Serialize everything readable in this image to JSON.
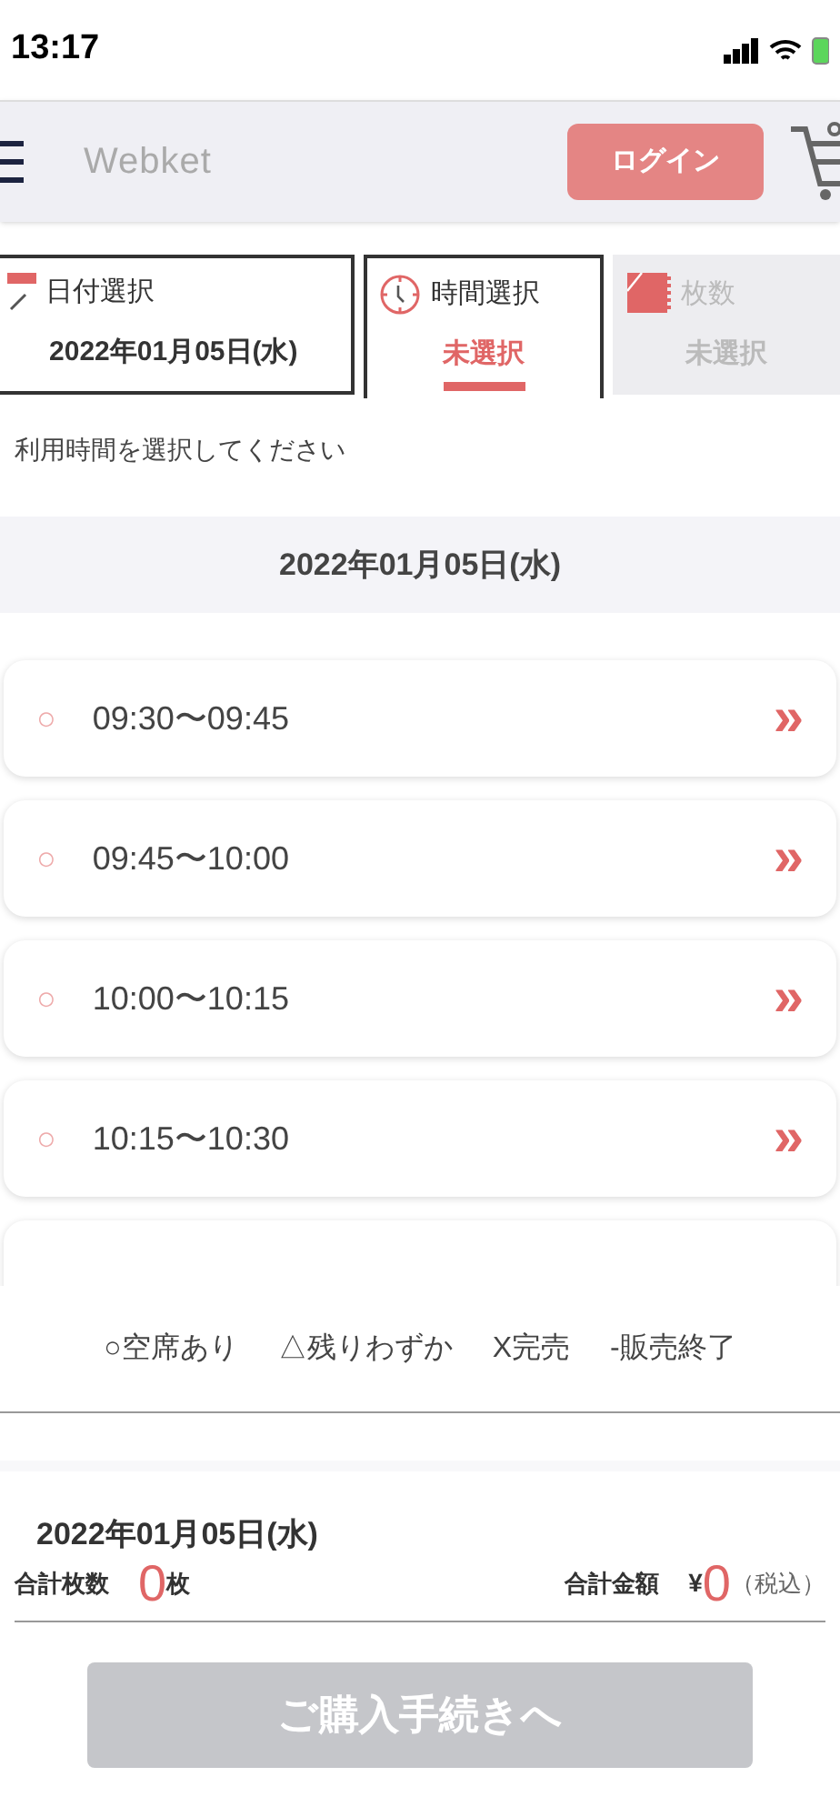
{
  "status_bar": {
    "time": "13:17"
  },
  "header": {
    "logo": "Webket",
    "login_button": "ログイン"
  },
  "steps": [
    {
      "kind": "calendar",
      "label": "日付選択",
      "value": "2022年01月05日(水)",
      "selected": false,
      "disabled": false
    },
    {
      "kind": "clock",
      "label": "時間選択",
      "value": "未選択",
      "selected": true,
      "disabled": false
    },
    {
      "kind": "ticket",
      "label": "枚数",
      "value": "未選択",
      "selected": false,
      "disabled": true
    }
  ],
  "prompt": "利用時間を選択してください",
  "date_heading": "2022年01月05日(水)",
  "slots": [
    {
      "mark": "○",
      "time": "09:30〜09:45",
      "arrow": "»"
    },
    {
      "mark": "○",
      "time": "09:45〜10:00",
      "arrow": "»"
    },
    {
      "mark": "○",
      "time": "10:00〜10:15",
      "arrow": "»"
    },
    {
      "mark": "○",
      "time": "10:15〜10:30",
      "arrow": "»"
    }
  ],
  "legend": [
    "○空席あり",
    "△残りわずか",
    "X完売",
    "-販売終了"
  ],
  "summary": {
    "date": "2022年01月05日(水)",
    "count_label": "合計枚数",
    "count": "0",
    "count_unit": "枚",
    "amount_label": "合計金額",
    "currency": "¥",
    "amount": "0",
    "tax_note": "（税込）"
  },
  "purchase_button": {
    "label": "ご購入手続きへ",
    "disabled": true
  }
}
